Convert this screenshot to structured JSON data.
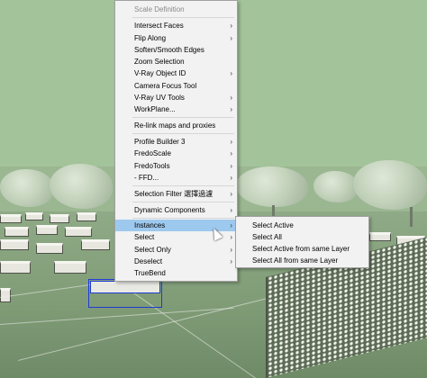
{
  "context_menu": {
    "header": "Scale Definition",
    "items": [
      {
        "label": "Intersect Faces",
        "submenu": true
      },
      {
        "label": "Flip Along",
        "submenu": true
      },
      {
        "label": "Soften/Smooth Edges",
        "submenu": false
      },
      {
        "label": "Zoom Selection",
        "submenu": false
      },
      {
        "label": "V-Ray Object ID",
        "submenu": true
      },
      {
        "label": "Camera Focus Tool",
        "submenu": false
      },
      {
        "label": "V-Ray UV Tools",
        "submenu": true
      },
      {
        "label": "WorkPlane...",
        "submenu": true
      },
      {
        "label": "Re-link maps and proxies",
        "submenu": false
      },
      {
        "label": "Profile Builder 3",
        "submenu": true
      },
      {
        "label": "FredoScale",
        "submenu": true
      },
      {
        "label": "FredoTools",
        "submenu": true
      },
      {
        "label": "- FFD...",
        "submenu": true
      },
      {
        "label": "Selection Filter 選擇過濾",
        "submenu": true
      },
      {
        "label": "Dynamic Components",
        "submenu": true
      },
      {
        "label": "Instances",
        "submenu": true
      },
      {
        "label": "Select",
        "submenu": true
      },
      {
        "label": "Select Only",
        "submenu": true
      },
      {
        "label": "Deselect",
        "submenu": true
      },
      {
        "label": "TrueBend",
        "submenu": false
      }
    ]
  },
  "instances_submenu": {
    "items": [
      {
        "label": "Select Active"
      },
      {
        "label": "Select All"
      },
      {
        "label": "Select Active from same Layer"
      },
      {
        "label": "Select All from same Layer"
      }
    ]
  },
  "icons": {
    "submenu_arrow": "›"
  },
  "colors": {
    "highlight": "#9ec9ef",
    "selection": "#1f3bd6",
    "menu_bg": "#f2f2f2"
  }
}
